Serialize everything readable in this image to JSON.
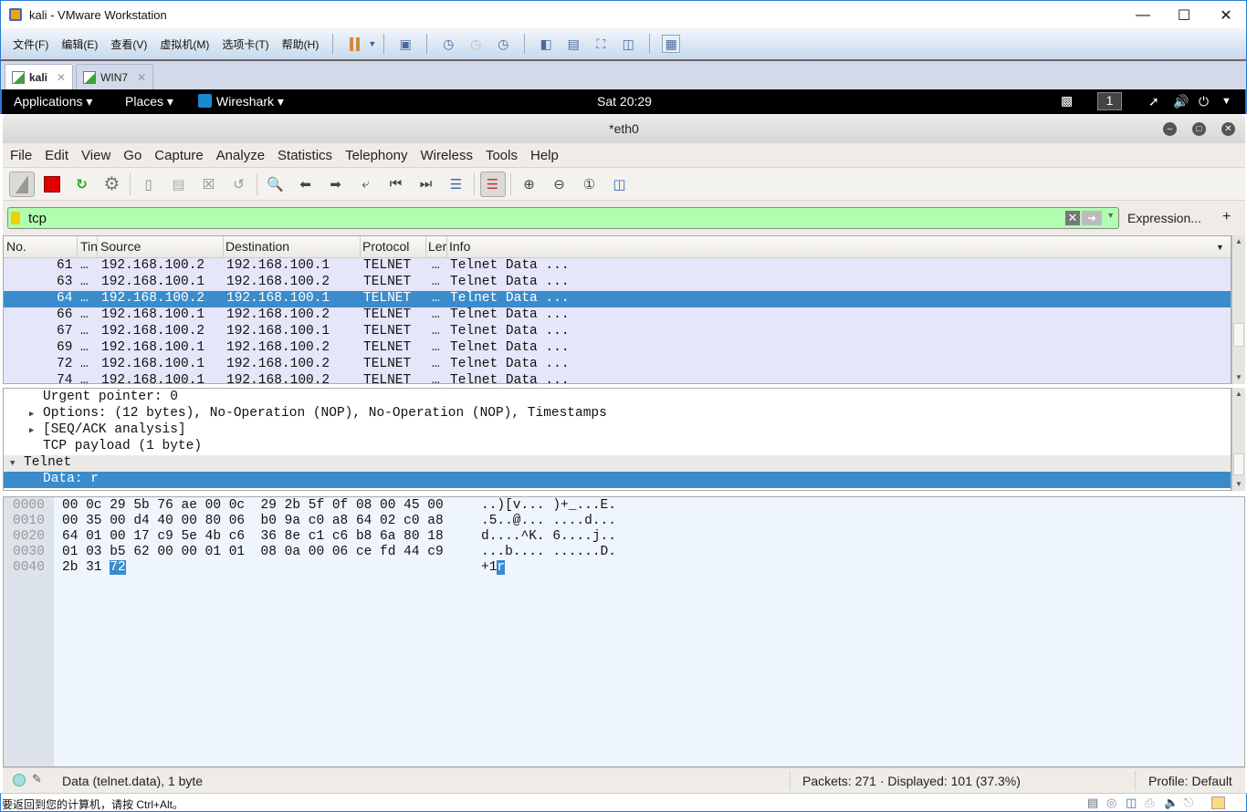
{
  "vmware": {
    "title": "kali - VMware Workstation",
    "menu": [
      "文件(F)",
      "编辑(E)",
      "查看(V)",
      "虚拟机(M)",
      "选项卡(T)",
      "帮助(H)"
    ],
    "tabs": [
      {
        "label": "kali",
        "active": true
      },
      {
        "label": "WIN7",
        "active": false
      }
    ],
    "status_hint": "要返回到您的计算机，请按 Ctrl+Alt。"
  },
  "kali": {
    "applications": "Applications",
    "places": "Places",
    "app": "Wireshark",
    "clock": "Sat 20:29",
    "workspace": "1"
  },
  "wireshark": {
    "title": "*eth0",
    "menu": [
      "File",
      "Edit",
      "View",
      "Go",
      "Capture",
      "Analyze",
      "Statistics",
      "Telephony",
      "Wireless",
      "Tools",
      "Help"
    ],
    "filter": {
      "value": "tcp"
    },
    "expression_label": "Expression...",
    "plus_label": "+",
    "columns": [
      "No.",
      "Tin",
      "Source",
      "Destination",
      "Protocol",
      "Ler",
      "Info"
    ],
    "packets": [
      {
        "no": "61",
        "time": "…",
        "src": "192.168.100.2",
        "dst": "192.168.100.1",
        "proto": "TELNET",
        "len": "…",
        "info": "Telnet Data ..."
      },
      {
        "no": "63",
        "time": "…",
        "src": "192.168.100.1",
        "dst": "192.168.100.2",
        "proto": "TELNET",
        "len": "…",
        "info": "Telnet Data ..."
      },
      {
        "no": "64",
        "time": "…",
        "src": "192.168.100.2",
        "dst": "192.168.100.1",
        "proto": "TELNET",
        "len": "…",
        "info": "Telnet Data ...",
        "selected": true
      },
      {
        "no": "66",
        "time": "…",
        "src": "192.168.100.1",
        "dst": "192.168.100.2",
        "proto": "TELNET",
        "len": "…",
        "info": "Telnet Data ..."
      },
      {
        "no": "67",
        "time": "…",
        "src": "192.168.100.2",
        "dst": "192.168.100.1",
        "proto": "TELNET",
        "len": "…",
        "info": "Telnet Data ..."
      },
      {
        "no": "69",
        "time": "…",
        "src": "192.168.100.1",
        "dst": "192.168.100.2",
        "proto": "TELNET",
        "len": "…",
        "info": "Telnet Data ..."
      },
      {
        "no": "72",
        "time": "…",
        "src": "192.168.100.1",
        "dst": "192.168.100.2",
        "proto": "TELNET",
        "len": "…",
        "info": "Telnet Data ..."
      },
      {
        "no": "74",
        "time": "…",
        "src": "192.168.100.1",
        "dst": "192.168.100.2",
        "proto": "TELNET",
        "len": "…",
        "info": "Telnet Data ..."
      }
    ],
    "details": [
      {
        "text": "Urgent pointer: 0",
        "indent": 2,
        "arrow": ""
      },
      {
        "text": "Options: (12 bytes), No-Operation (NOP), No-Operation (NOP), Timestamps",
        "indent": 2,
        "arrow": "right"
      },
      {
        "text": "[SEQ/ACK analysis]",
        "indent": 2,
        "arrow": "right"
      },
      {
        "text": "TCP payload (1 byte)",
        "indent": 2,
        "arrow": ""
      },
      {
        "text": "Telnet",
        "indent": 1,
        "arrow": "down",
        "highlight": true
      },
      {
        "text": "Data: r",
        "indent": 2,
        "arrow": "",
        "selected": true
      }
    ],
    "bytes": [
      {
        "offset": "0000",
        "hex": "00 0c 29 5b 76 ae 00 0c  29 2b 5f 0f 08 00 45 00",
        "ascii": "..)[v... )+_...E."
      },
      {
        "offset": "0010",
        "hex": "00 35 00 d4 40 00 80 06  b0 9a c0 a8 64 02 c0 a8",
        "ascii": ".5..@... ....d..."
      },
      {
        "offset": "0020",
        "hex": "64 01 00 17 c9 5e 4b c6  36 8e c1 c6 b8 6a 80 18",
        "ascii": "d....^K. 6....j.."
      },
      {
        "offset": "0030",
        "hex": "01 03 b5 62 00 00 01 01  08 0a 00 06 ce fd 44 c9",
        "ascii": "...b.... ......D."
      },
      {
        "offset": "0040",
        "hex_plain": "2b 31 ",
        "hex_hl": "72",
        "ascii_plain": "+1",
        "ascii_hl": "r"
      }
    ],
    "status": {
      "field": "Data (telnet.data), 1 byte",
      "packets": "Packets: 271 · Displayed: 101 (37.3%)",
      "profile": "Profile: Default"
    }
  },
  "colors": {
    "selection": "#3a8ccc",
    "filter_ok": "#afffaf",
    "packet_row": "#e6e6fa"
  }
}
